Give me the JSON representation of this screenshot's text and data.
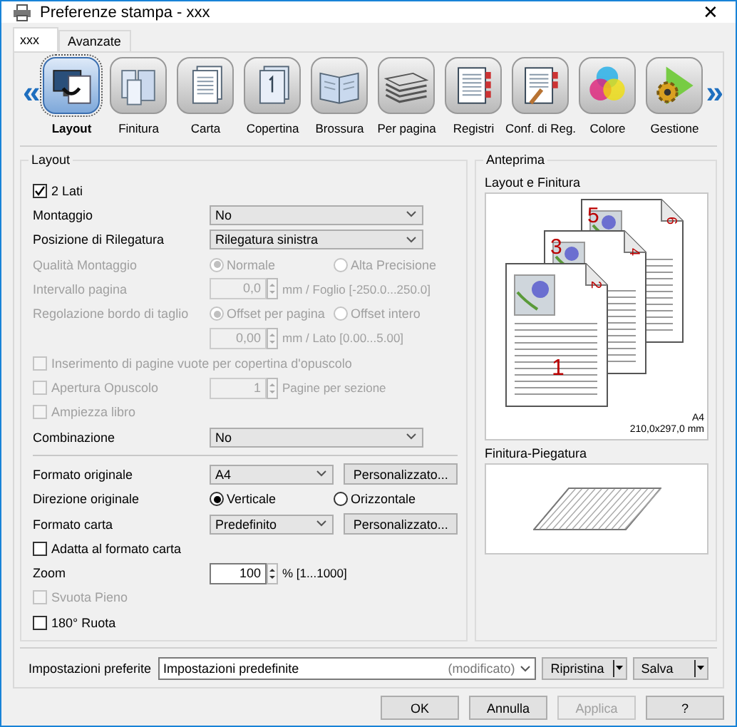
{
  "window": {
    "title": "Preferenze stampa - xxx",
    "close": "✕"
  },
  "tabs": [
    {
      "label": "xxx",
      "selected": true
    },
    {
      "label": "Avanzate",
      "selected": false
    }
  ],
  "toolbar": {
    "prev": "«",
    "next": "»",
    "items": [
      {
        "label": "Layout",
        "selected": true
      },
      {
        "label": "Finitura",
        "selected": false
      },
      {
        "label": "Carta",
        "selected": false
      },
      {
        "label": "Copertina",
        "selected": false
      },
      {
        "label": "Brossura",
        "selected": false
      },
      {
        "label": "Per pagina",
        "selected": false
      },
      {
        "label": "Registri",
        "selected": false
      },
      {
        "label": "Conf. di Reg.",
        "selected": false
      },
      {
        "label": "Colore",
        "selected": false
      },
      {
        "label": "Gestione",
        "selected": false
      }
    ]
  },
  "layout": {
    "title": "Layout",
    "rows": [
      {
        "kind": "checkbox",
        "label": "2 Lati",
        "checked": true,
        "disabled": false
      },
      {
        "kind": "select",
        "label": "Montaggio",
        "value": "No",
        "disabled": false
      },
      {
        "kind": "select",
        "label": "Posizione di Rilegatura",
        "value": "Rilegatura sinistra",
        "disabled": false
      },
      {
        "kind": "radio",
        "label": "Qualità Montaggio",
        "disabled": true,
        "options": [
          {
            "label": "Normale",
            "selected": true
          },
          {
            "label": "Alta Precisione",
            "selected": false
          }
        ]
      },
      {
        "kind": "spin",
        "label": "Intervallo pagina",
        "value": "0,0",
        "unit": "mm / Foglio [-250.0...250.0]",
        "disabled": true
      },
      {
        "kind": "radio",
        "label": "Regolazione bordo di taglio",
        "disabled": true,
        "options": [
          {
            "label": "Offset per pagina",
            "selected": true
          },
          {
            "label": "Offset intero",
            "selected": false
          }
        ]
      },
      {
        "kind": "spin",
        "value": "0,00",
        "unit": "mm / Lato [0.00...5.00]",
        "disabled": true
      },
      {
        "kind": "checkbox",
        "label": "Inserimento di pagine vuote per copertina d'opuscolo",
        "checked": false,
        "disabled": true
      },
      {
        "kind": "checkspin",
        "label": "Apertura Opuscolo",
        "checked": false,
        "value": "1",
        "unit": "Pagine per sezione",
        "disabled": true
      },
      {
        "kind": "checkbox",
        "label": "Ampiezza libro",
        "checked": false,
        "disabled": true
      },
      {
        "kind": "select",
        "label": "Combinazione",
        "value": "No",
        "disabled": false
      },
      {
        "kind": "divider"
      },
      {
        "kind": "select_button",
        "label": "Formato originale",
        "value": "A4",
        "button": "Personalizzato...",
        "disabled": false
      },
      {
        "kind": "radio",
        "label": "Direzione originale",
        "disabled": false,
        "options": [
          {
            "label": "Verticale",
            "selected": true
          },
          {
            "label": "Orizzontale",
            "selected": false
          }
        ]
      },
      {
        "kind": "select_button",
        "label": "Formato carta",
        "value": "Predefinito",
        "button": "Personalizzato...",
        "disabled": false
      },
      {
        "kind": "checkbox",
        "label": "Adatta al formato carta",
        "checked": false,
        "disabled": false
      },
      {
        "kind": "spin",
        "label": "Zoom",
        "value": "100",
        "unit": "% [1...1000]",
        "disabled": false
      },
      {
        "kind": "checkbox",
        "label": "Svuota Pieno",
        "checked": false,
        "disabled": true
      },
      {
        "kind": "checkbox",
        "label": "180° Ruota",
        "checked": false,
        "disabled": false
      }
    ]
  },
  "preview": {
    "title": "Anteprima",
    "layout_label": "Layout e Finitura",
    "page_numbers": [
      "1",
      "2",
      "3",
      "4",
      "5",
      "6"
    ],
    "paper": "A4",
    "paper_size": "210,0x297,0 mm",
    "finishing_label": "Finitura-Piegatura"
  },
  "favorites": {
    "label": "Impostazioni preferite",
    "value": "Impostazioni predefinite",
    "note": "(modificato)",
    "buttons": [
      "Ripristina",
      "Salva"
    ]
  },
  "buttons": [
    {
      "label": "OK",
      "disabled": false
    },
    {
      "label": "Annulla",
      "disabled": false
    },
    {
      "label": "Applica",
      "disabled": true
    },
    {
      "label": "?",
      "disabled": false
    }
  ]
}
